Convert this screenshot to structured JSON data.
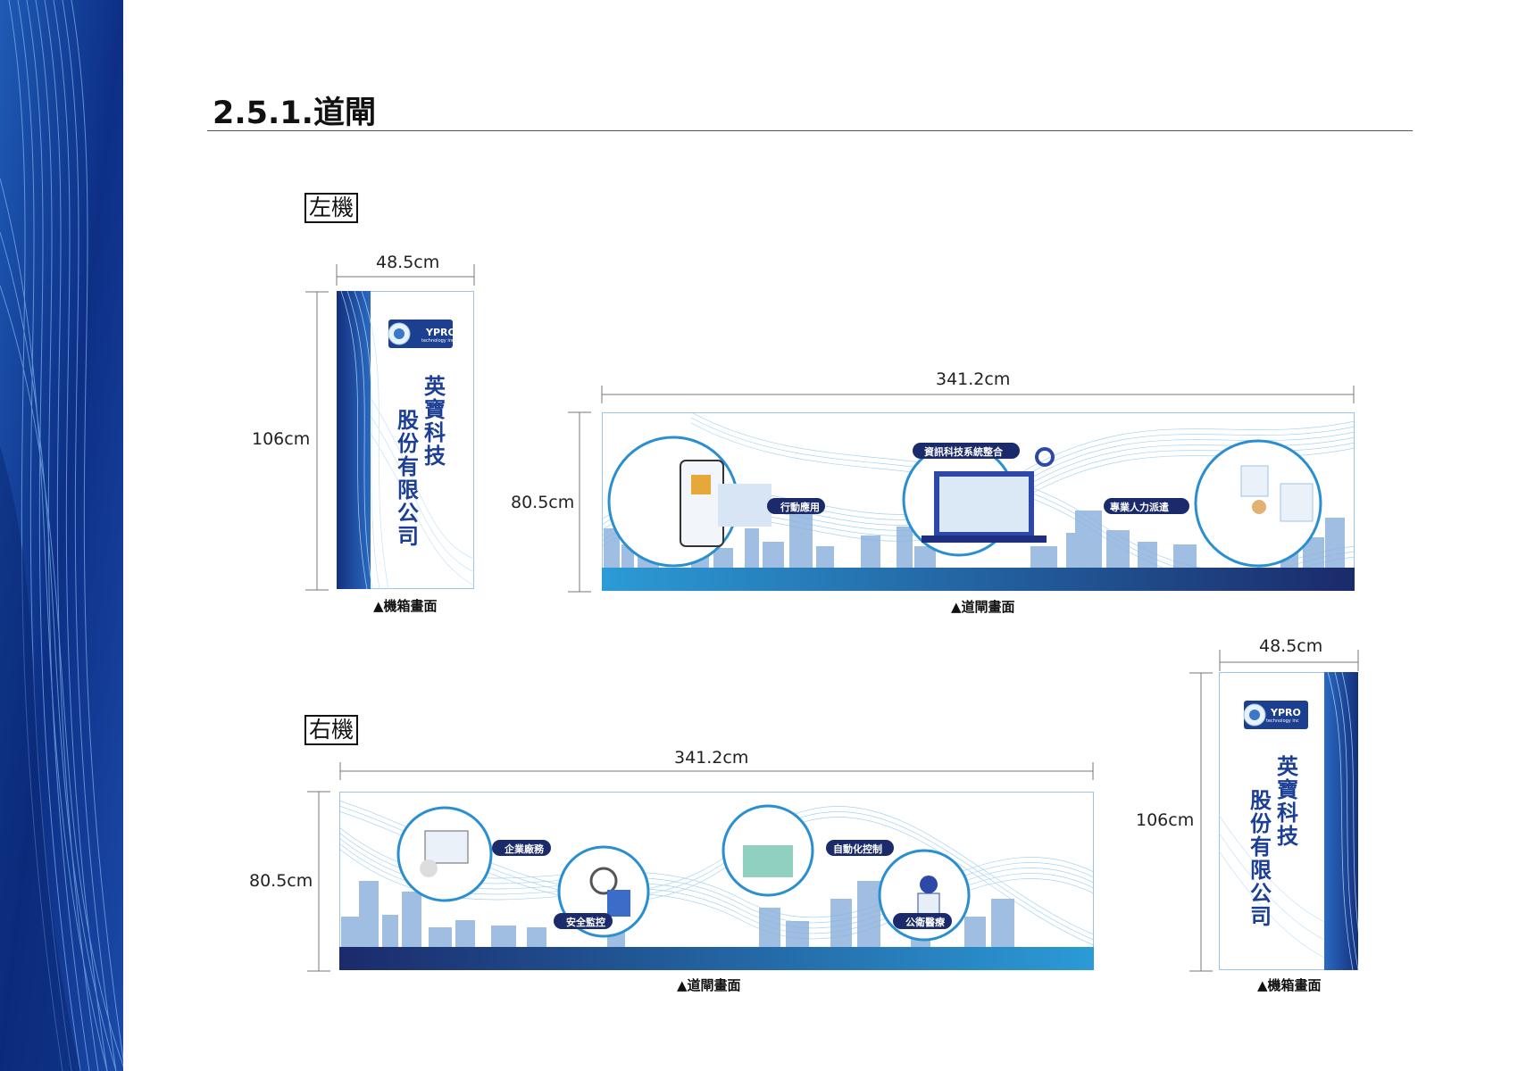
{
  "page": {
    "title": "2.5.1.道閘"
  },
  "left_machine": {
    "label": "左機",
    "box_width": "48.5cm",
    "box_height": "106cm",
    "box_caption": "▲機箱畫面",
    "gate_width": "341.2cm",
    "gate_height": "80.5cm",
    "gate_caption": "▲道閘畫面",
    "tags": [
      "行動應用",
      "資訊科技系統整合",
      "專業人力派遣"
    ]
  },
  "right_machine": {
    "label": "右機",
    "box_width": "48.5cm",
    "box_height": "106cm",
    "box_caption": "▲機箱畫面",
    "gate_width": "341.2cm",
    "gate_height": "80.5cm",
    "gate_caption": "▲道閘畫面",
    "tags": [
      "企業廠務",
      "安全監控",
      "自動化控制",
      "公衛醫療"
    ]
  },
  "brand": {
    "logo_text": "YPRO",
    "logo_sub": "technology inc",
    "company_line1": "英寶科技",
    "company_line2": "股份有限公司"
  },
  "colors": {
    "navy": "#1b2a6b",
    "blue": "#1e5aa8",
    "light_blue": "#2b9bd6",
    "sky": "#8fc3ea"
  }
}
